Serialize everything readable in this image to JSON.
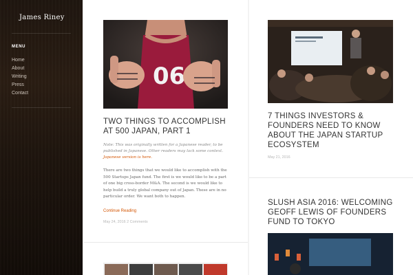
{
  "sidebar": {
    "logo": "James Riney",
    "menu_heading": "MENU",
    "items": [
      {
        "label": "Home"
      },
      {
        "label": "About"
      },
      {
        "label": "Writing"
      },
      {
        "label": "Press"
      },
      {
        "label": "Contact"
      }
    ]
  },
  "posts": {
    "post1": {
      "title": "Two Things to Accomplish at 500 Japan, Part 1",
      "note": "Note: This was originally written for a Japanese reader, to be published in Japanese. Other readers may lack some context.",
      "note_link": "Japanese version is here.",
      "body": "There are two things that we would like to accomplish with the 500 Startups Japan fund. The first is we would like to be a part of one big cross-border M&A. The second is we would like to help build a truly global company out of Japan. These are in no particular order. We want both to happen.",
      "continue_label": "Continue Reading",
      "date": "May 24, 2016",
      "comments": "2 Comments",
      "image_text": "06"
    },
    "post2": {
      "title": "7 Things Investors & Founders Need to Know About the Japan Startup Ecosystem",
      "date": "May 21, 2016"
    },
    "post3": {
      "title": "Slush Asia 2016: Welcoming Geoff Lewis of Founders Fund to Tokyo"
    }
  },
  "colors": {
    "accent": "#d35400",
    "title": "#333333",
    "meta": "#b5b5b5"
  }
}
